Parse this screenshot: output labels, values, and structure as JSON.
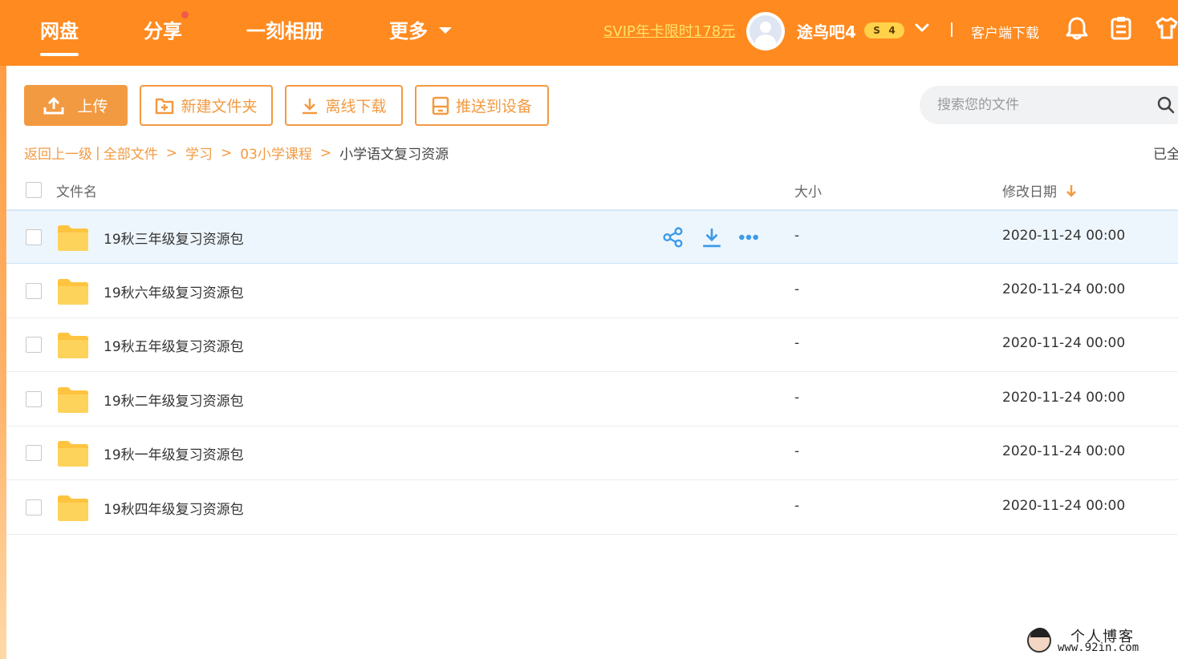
{
  "nav": {
    "items": [
      "网盘",
      "分享",
      "一刻相册",
      "更多"
    ],
    "active_index": 0,
    "share_has_notification": true
  },
  "header": {
    "svip_promo": "SVIP年卡限时178元",
    "username": "途鸟吧4",
    "badge_symbol": "S",
    "badge_level": "4",
    "client_download": "客户端下载"
  },
  "toolbar": {
    "upload": "上传",
    "new_folder": "新建文件夹",
    "offline_download": "离线下载",
    "push_to_device": "推送到设备"
  },
  "search": {
    "placeholder": "搜索您的文件"
  },
  "breadcrumb": {
    "back": "返回上一级",
    "separator_bar": "|",
    "all_files": "全部文件",
    "sep": ">",
    "level1": "学习",
    "level2": "03小学课程",
    "current": "小学语文复习资源"
  },
  "status_text": "已全",
  "columns": {
    "name": "文件名",
    "size": "大小",
    "modified": "修改日期",
    "sort_direction": "desc"
  },
  "files": [
    {
      "name": "19秋三年级复习资源包",
      "size": "-",
      "modified": "2020-11-24 00:00"
    },
    {
      "name": "19秋六年级复习资源包",
      "size": "-",
      "modified": "2020-11-24 00:00"
    },
    {
      "name": "19秋五年级复习资源包",
      "size": "-",
      "modified": "2020-11-24 00:00"
    },
    {
      "name": "19秋二年级复习资源包",
      "size": "-",
      "modified": "2020-11-24 00:00"
    },
    {
      "name": "19秋一年级复习资源包",
      "size": "-",
      "modified": "2020-11-24 00:00"
    },
    {
      "name": "19秋四年级复习资源包",
      "size": "-",
      "modified": "2020-11-24 00:00"
    }
  ],
  "row_actions": [
    "share-icon",
    "download-icon",
    "more-icon"
  ],
  "watermark": {
    "title": "个人博客",
    "url": "www.92in.com"
  },
  "colors": {
    "brand_orange": "#ff8a1f",
    "accent": "#f29a42",
    "action_blue": "#3d9be9",
    "folder_yellow": "#fed35c"
  }
}
